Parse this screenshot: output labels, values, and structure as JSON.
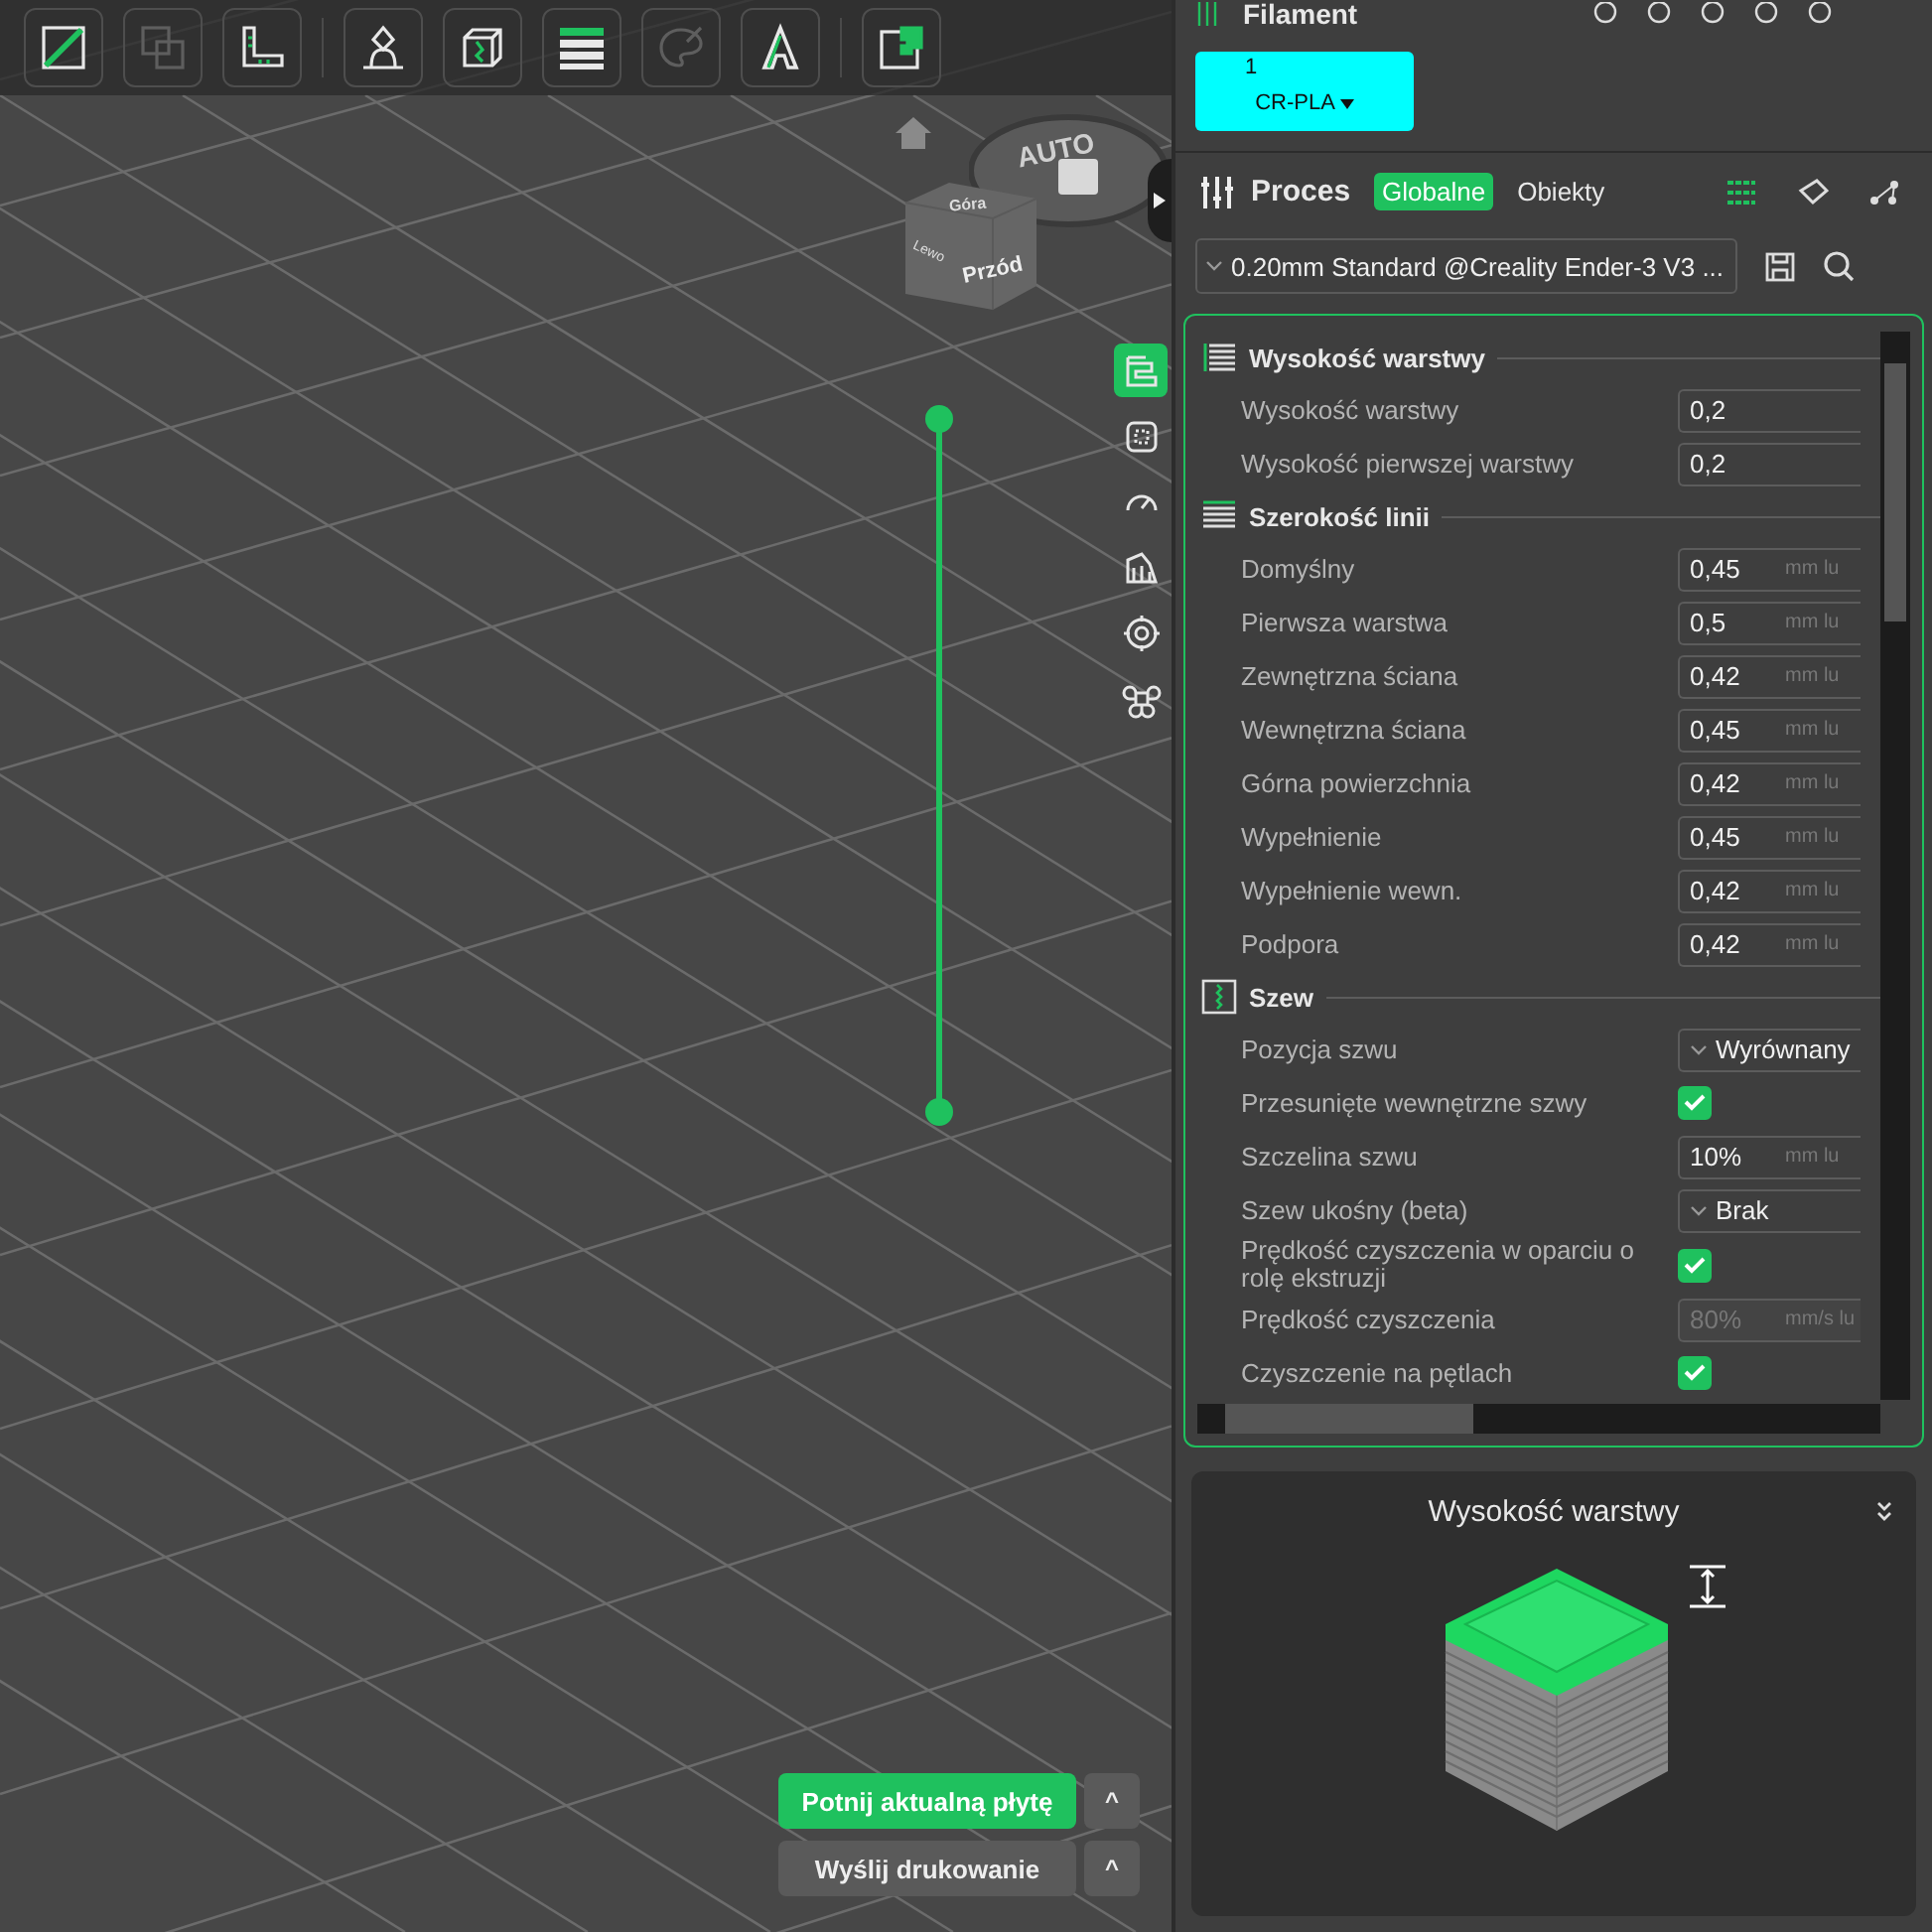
{
  "toolbar": [
    {
      "kind": "slash",
      "disabled": false
    },
    {
      "kind": "overlap",
      "disabled": true
    },
    {
      "kind": "ruler",
      "disabled": false
    },
    {
      "kind": "bust",
      "disabled": false
    },
    {
      "kind": "cube",
      "disabled": false
    },
    {
      "kind": "layers",
      "disabled": false
    },
    {
      "kind": "palette",
      "disabled": true
    },
    {
      "kind": "letter",
      "disabled": false
    },
    {
      "kind": "puzzle",
      "disabled": false
    }
  ],
  "view_cube": {
    "top": "Góra",
    "left": "Lewo",
    "front": "Przód"
  },
  "auto_dial": {
    "label": "AUTO"
  },
  "layer_slider": {
    "upper": {
      "level": 1
    },
    "lower": {
      "level": 0
    }
  },
  "side_tools": [
    {
      "kind": "layers",
      "selected": true
    },
    {
      "kind": "select",
      "selected": false
    },
    {
      "kind": "gauge",
      "selected": false
    },
    {
      "kind": "support",
      "selected": false
    },
    {
      "kind": "target",
      "selected": false
    },
    {
      "kind": "clover",
      "selected": false
    }
  ],
  "actions": [
    {
      "label": "Potnij aktualną płytę",
      "caret": "^",
      "primary": true
    },
    {
      "label": "Wyślij drukowanie",
      "caret": "^",
      "primary": false
    }
  ],
  "filament": {
    "title": "Filament",
    "slots": [
      {
        "number": "1",
        "name": "CR-PLA",
        "color": "#00ffff"
      }
    ]
  },
  "process": {
    "title": "Proces",
    "tabs": [
      {
        "label": "Globalne",
        "selected": true
      },
      {
        "label": "Obiekty",
        "selected": false
      }
    ],
    "preset": "0.20mm Standard @Creality Ender-3 V3 ..."
  },
  "settings": [
    {
      "title": "Wysokość warstwy",
      "rows": [
        {
          "kind": "number",
          "label": "Wysokość warstwy",
          "value": "0,2",
          "disabled": false
        },
        {
          "kind": "number",
          "label": "Wysokość pierwszej warstwy",
          "value": "0,2",
          "disabled": false
        }
      ]
    },
    {
      "title": "Szerokość linii",
      "rows": [
        {
          "kind": "number",
          "label": "Domyślny",
          "value": "0,45",
          "unit": "mm lu",
          "disabled": false
        },
        {
          "kind": "number",
          "label": "Pierwsza warstwa",
          "value": "0,5",
          "unit": "mm lu",
          "disabled": false
        },
        {
          "kind": "number",
          "label": "Zewnętrzna ściana",
          "value": "0,42",
          "unit": "mm lu",
          "disabled": false
        },
        {
          "kind": "number",
          "label": "Wewnętrzna ściana",
          "value": "0,45",
          "unit": "mm lu",
          "disabled": false
        },
        {
          "kind": "number",
          "label": "Górna powierzchnia",
          "value": "0,42",
          "unit": "mm lu",
          "disabled": false
        },
        {
          "kind": "number",
          "label": "Wypełnienie",
          "value": "0,45",
          "unit": "mm lu",
          "disabled": false
        },
        {
          "kind": "number",
          "label": "Wypełnienie wewn.",
          "value": "0,42",
          "unit": "mm lu",
          "disabled": false
        },
        {
          "kind": "number",
          "label": "Podpora",
          "value": "0,42",
          "unit": "mm lu",
          "disabled": false
        }
      ]
    },
    {
      "title": "Szew",
      "rows": [
        {
          "kind": "combo",
          "label": "Pozycja szwu",
          "value": "Wyrównany",
          "disabled": false
        },
        {
          "kind": "checkbox",
          "label": "Przesunięte wewnętrzne szwy",
          "checked": true,
          "disabled": false
        },
        {
          "kind": "number",
          "label": "Szczelina szwu",
          "value": "10%",
          "unit": "mm lu",
          "disabled": false
        },
        {
          "kind": "combo",
          "label": "Szew ukośny (beta)",
          "value": "Brak",
          "disabled": false
        },
        {
          "kind": "checkbox",
          "label": "Prędkość czyszczenia w oparciu o rolę ekstruzji",
          "checked": true,
          "disabled": false
        },
        {
          "kind": "number",
          "label": "Prędkość czyszczenia",
          "value": "80%",
          "unit": "mm/s lu",
          "disabled": true
        },
        {
          "kind": "checkbox",
          "label": "Czyszczenie na pętlach",
          "checked": true,
          "disabled": false
        }
      ]
    }
  ],
  "info_card": {
    "title": "Wysokość warstwy"
  }
}
